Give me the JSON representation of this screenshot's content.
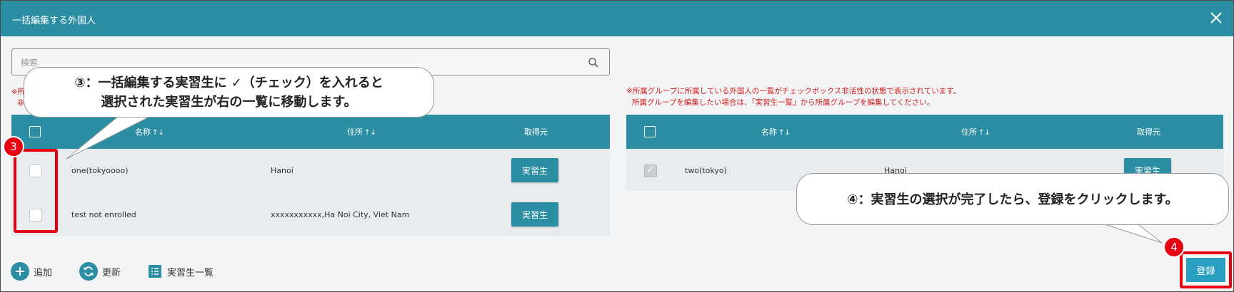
{
  "modal": {
    "title": "一括編集する外国人",
    "close_icon": "close-icon"
  },
  "search": {
    "placeholder": "検索",
    "icon": "search-icon"
  },
  "left_note_fragment": [
    "※所",
    "非"
  ],
  "note": {
    "line1": "※所属グループに所属している外国人の一覧がチェックボックス非活性の状態で表示されています。",
    "line2": "所属グループを編集したい場合は、「実習生一覧」から所属グループを編集してください。"
  },
  "left_table": {
    "columns": {
      "name": "名称",
      "address": "住所",
      "source": "取得元"
    },
    "rows": [
      {
        "name": "one(tokyoooo)",
        "address": "Hanoi",
        "source": "実習生"
      },
      {
        "name": "test not enrolled",
        "address": "xxxxxxxxxxx,Ha Noi City, Viet Nam",
        "source": "実習生"
      }
    ]
  },
  "right_table": {
    "columns": {
      "name": "名称",
      "address": "住所",
      "source": "取得元"
    },
    "rows": [
      {
        "name": "two(tokyo)",
        "address": "Hanoi",
        "source": "実習生",
        "checked": true,
        "disabled": true
      }
    ]
  },
  "sort_icon": "↑↓",
  "footer": {
    "add": "追加",
    "refresh": "更新",
    "trainee_list": "実習生一覧",
    "register": "登録"
  },
  "annotations": {
    "badge3": "3",
    "badge4": "4",
    "callout3_line1": "③：一括編集する実習生に ✓（チェック）を入れると",
    "callout3_line2": "選択された実習生が右の一覧に移動します。",
    "callout4": "④：実習生の選択が完了したら、登録をクリックします。"
  },
  "colors": {
    "primary": "#2b8ea3",
    "highlight": "#e60012",
    "warning_text": "#d21c1c"
  }
}
